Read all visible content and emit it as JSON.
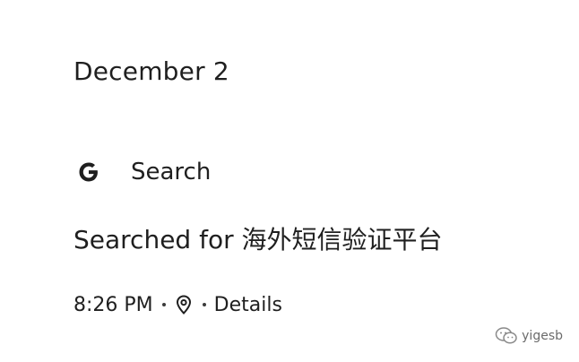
{
  "date_header": "December 2",
  "product": {
    "icon": "google-g-icon",
    "label": "Search"
  },
  "activity": {
    "title": "Searched for 海外短信验证平台"
  },
  "meta": {
    "time": "8:26 PM",
    "location_icon": "location-pin-icon",
    "details_label": "Details"
  },
  "watermark": {
    "text": "yigesb"
  },
  "colors": {
    "text": "#1f1f1f",
    "background": "#ffffff",
    "watermark": "#6b6b6b"
  }
}
